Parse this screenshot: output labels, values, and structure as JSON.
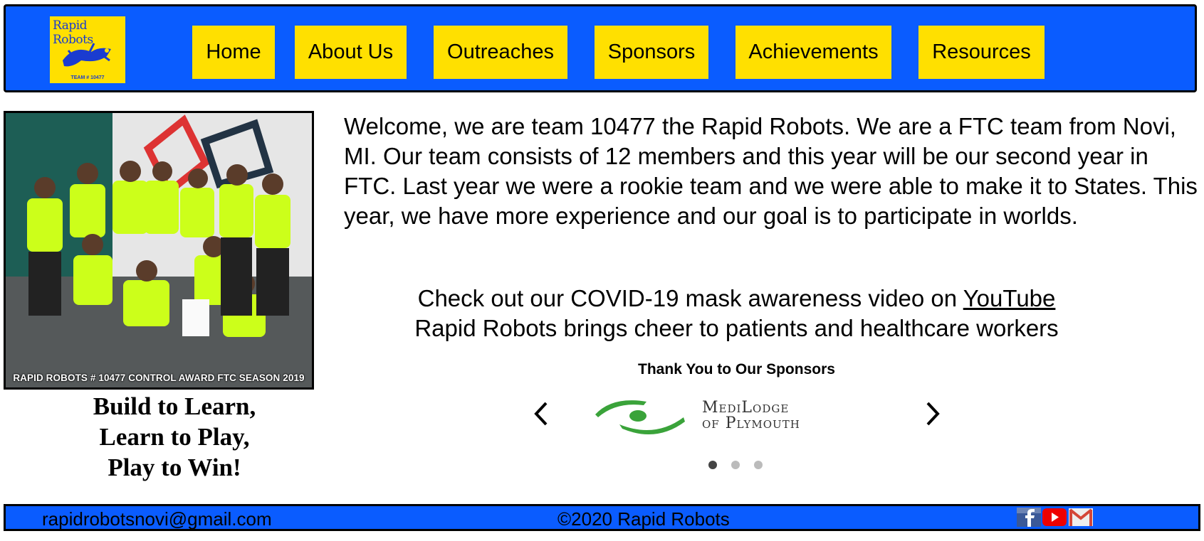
{
  "header": {
    "logo": {
      "title": "Rapid Robots",
      "team": "TEAM # 10477"
    },
    "nav": [
      {
        "label": "Home"
      },
      {
        "label": "About Us"
      },
      {
        "label": "Outreaches"
      },
      {
        "label": "Sponsors"
      },
      {
        "label": "Achievements"
      },
      {
        "label": "Resources"
      }
    ]
  },
  "photo": {
    "caption": "RAPID ROBOTS # 10477 CONTROL AWARD FTC SEASON 2019"
  },
  "motto": [
    "Build to Learn,",
    "Learn to Play,",
    "Play to Win!"
  ],
  "main": {
    "welcome": "Welcome, we are team 10477 the Rapid Robots. We are a FTC team from Novi, MI. Our team consists of 12 members and this year will be our second year in FTC. Last year we were a rookie team and we were able to make it to States. This year, we have more experience and our goal is to participate in worlds.",
    "covid_prefix": "Check out our COVID-19 mask awareness video on ",
    "covid_link": "YouTube",
    "cheer": "Rapid Robots brings cheer to patients and healthcare workers"
  },
  "sponsors": {
    "title": "Thank You to Our Sponsors",
    "current": {
      "line1": "MediLodge",
      "line2": "of Plymouth"
    },
    "slide_count": 3,
    "active_index": 0,
    "icons": {
      "prev": "chevron-left-icon",
      "next": "chevron-right-icon"
    }
  },
  "footer": {
    "email": "rapidrobotsnovi@gmail.com",
    "copyright": "©2020 Rapid Robots",
    "social": [
      "facebook-icon",
      "youtube-icon",
      "gmail-icon"
    ]
  },
  "colors": {
    "header_bg": "#0a5cff",
    "nav_button": "#ffe000",
    "sponsor_green": "#3aa33a"
  }
}
